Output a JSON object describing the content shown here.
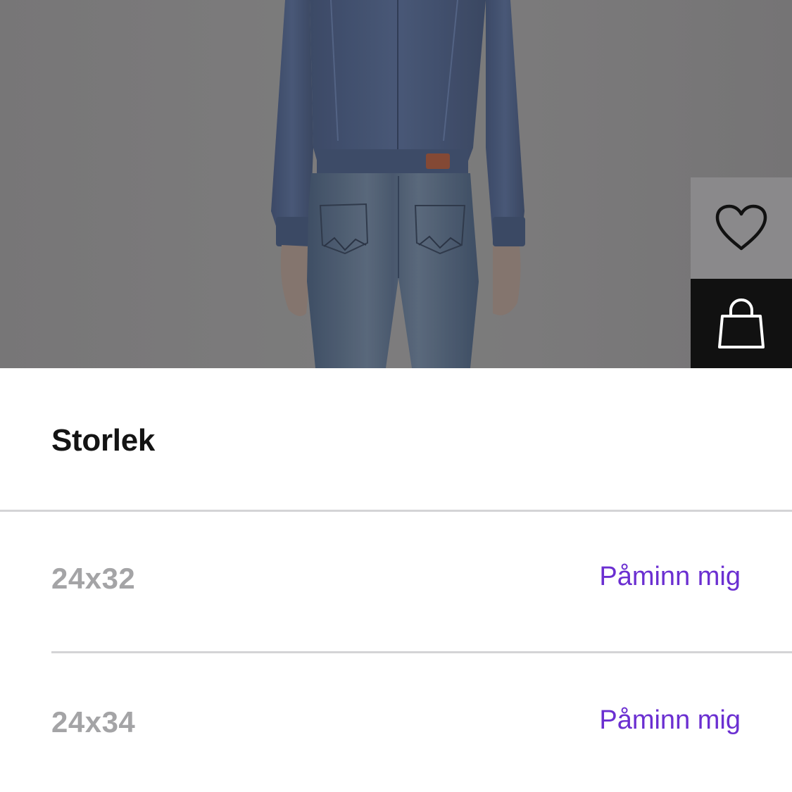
{
  "product_image": {
    "description_icon": "denim-jacket-jeans-photo"
  },
  "actions": {
    "wishlist_icon": "heart-icon",
    "bag_icon": "shopping-bag-icon"
  },
  "size_sheet": {
    "title": "Storlek",
    "sizes": [
      {
        "label": "24x32",
        "action": "Påminn mig"
      },
      {
        "label": "24x34",
        "action": "Påminn mig"
      }
    ]
  },
  "colors": {
    "accent": "#6b2fd1",
    "unavailable_text": "#a4a4a6",
    "bag_button_bg": "#111111"
  }
}
